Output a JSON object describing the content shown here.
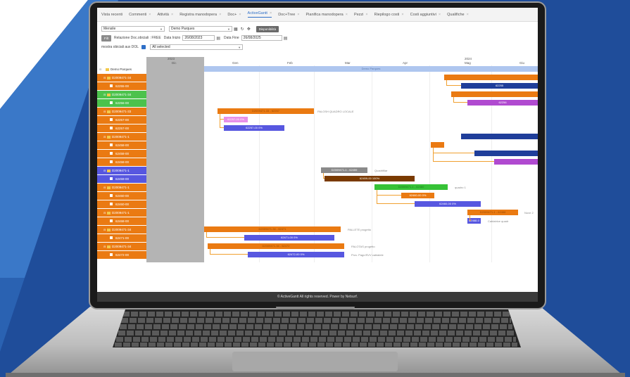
{
  "tabs": [
    {
      "label": "Vista recenti",
      "closable": false,
      "active": false
    },
    {
      "label": "Commenti",
      "closable": true,
      "active": false
    },
    {
      "label": "Attività",
      "closable": true,
      "active": false
    },
    {
      "label": "Registra manodopera",
      "closable": true,
      "active": false
    },
    {
      "label": "Doc+",
      "closable": true,
      "active": false
    },
    {
      "label": "ActiveGantt",
      "closable": true,
      "active": true
    },
    {
      "label": "Doc+Tree",
      "closable": true,
      "active": false
    },
    {
      "label": "Pianifica manodopera",
      "closable": true,
      "active": false
    },
    {
      "label": "Pezzi",
      "closable": true,
      "active": false
    },
    {
      "label": "Riepilogo costi",
      "closable": true,
      "active": false
    },
    {
      "label": "Costi aggiuntivi",
      "closable": true,
      "active": false
    },
    {
      "label": "Qualifiche",
      "closable": true,
      "active": false
    }
  ],
  "toolbar": {
    "mode_select": "Mensile",
    "project_select": "Demo Parques",
    "status_button": "Disponibilità",
    "filter_button": "Filt",
    "relazione_label": "Relazione Doc.obiciali : FREE",
    "data_inizio_label": "Data Inizio",
    "data_inizio_value": "26/08/2023",
    "data_fine_label": "Data Fine",
    "data_fine_value": "26/08/2025",
    "mostra_label": "mostra obiciali aux DOL",
    "all_selected": "All selected"
  },
  "timeline": {
    "years": [
      "2023",
      "2024"
    ],
    "months": [
      "Dic",
      "Gen",
      "Feb",
      "Mar",
      "Apr",
      "Mag",
      "Giu"
    ]
  },
  "rows": [
    {
      "label": "Demo Parques",
      "kind": "root",
      "color": "#ffffff"
    },
    {
      "label": "D2009471-34",
      "kind": "parent",
      "color": "#ea7a12"
    },
    {
      "label": "62255-00",
      "kind": "child",
      "color": "#ea7a12"
    },
    {
      "label": "D2009471-34",
      "kind": "parent",
      "color": "#4cc24c"
    },
    {
      "label": "62256-00",
      "kind": "child",
      "color": "#4cc24c"
    },
    {
      "label": "D2009471-33",
      "kind": "parent",
      "color": "#ea7a12"
    },
    {
      "label": "62257-00",
      "kind": "child",
      "color": "#ea7a12"
    },
    {
      "label": "62257-00",
      "kind": "child",
      "color": "#ea7a12"
    },
    {
      "label": "D2009471-1",
      "kind": "parent",
      "color": "#ea7a12"
    },
    {
      "label": "62458-00",
      "kind": "child",
      "color": "#ea7a12"
    },
    {
      "label": "62458-00",
      "kind": "child",
      "color": "#ea7a12"
    },
    {
      "label": "62458-00",
      "kind": "child",
      "color": "#ea7a12"
    },
    {
      "label": "D2009471-1",
      "kind": "parent",
      "color": "#5757e0"
    },
    {
      "label": "62459-00",
      "kind": "child",
      "color": "#5757e0"
    },
    {
      "label": "D2009471-1",
      "kind": "parent",
      "color": "#ea7a12"
    },
    {
      "label": "62460-00",
      "kind": "child",
      "color": "#ea7a12"
    },
    {
      "label": "62460-00",
      "kind": "child",
      "color": "#ea7a12"
    },
    {
      "label": "D2009471-1",
      "kind": "parent",
      "color": "#ea7a12"
    },
    {
      "label": "62468-00",
      "kind": "child",
      "color": "#ea7a12"
    },
    {
      "label": "D2009471-34",
      "kind": "parent",
      "color": "#ea7a12"
    },
    {
      "label": "62471-00",
      "kind": "child",
      "color": "#ea7a12"
    },
    {
      "label": "D2009471-34",
      "kind": "parent",
      "color": "#ea7a12"
    },
    {
      "label": "62472-00",
      "kind": "child",
      "color": "#ea7a12"
    }
  ],
  "bars": [
    {
      "row": 0,
      "start": 0.0,
      "end": 1.0,
      "color": "#aec6ef",
      "text": "Demo Parques",
      "textColor": "#5a7ab0"
    },
    {
      "row": 1,
      "start": 0.72,
      "end": 1.0,
      "color": "#ea7a12",
      "text": ""
    },
    {
      "row": 2,
      "start": 0.77,
      "end": 1.0,
      "color": "#1f3e9a",
      "text": "62255"
    },
    {
      "row": 3,
      "start": 0.74,
      "end": 1.0,
      "color": "#ea7a12",
      "text": ""
    },
    {
      "row": 4,
      "start": 0.79,
      "end": 1.0,
      "color": "#b04ad0",
      "text": "62256"
    },
    {
      "row": 5,
      "start": 0.04,
      "end": 0.33,
      "color": "#ea7a12",
      "text": "D2009471-33 - 62257",
      "textColor": "#9a4a00"
    },
    {
      "row": 6,
      "start": 0.06,
      "end": 0.13,
      "color": "#e890e8",
      "text": "62257-00 0%"
    },
    {
      "row": 7,
      "start": 0.06,
      "end": 0.24,
      "color": "#5757e0",
      "text": "62257-00 0%"
    },
    {
      "row": 8,
      "start": 0.77,
      "end": 1.0,
      "color": "#1f3e9a",
      "text": ""
    },
    {
      "row": 9,
      "start": 0.68,
      "end": 0.72,
      "color": "#ea7a12",
      "text": ""
    },
    {
      "row": 10,
      "start": 0.81,
      "end": 1.0,
      "color": "#1f3e9a",
      "text": ""
    },
    {
      "row": 11,
      "start": 0.87,
      "end": 1.0,
      "color": "#b04ad0",
      "text": ""
    },
    {
      "row": 12,
      "start": 0.35,
      "end": 0.49,
      "color": "#8a8a8a",
      "text": "D2009471-1 - 62459"
    },
    {
      "row": 13,
      "start": 0.36,
      "end": 0.63,
      "color": "#7a3a00",
      "text": "62459-00 100%"
    },
    {
      "row": 14,
      "start": 0.51,
      "end": 0.73,
      "color": "#36c236",
      "text": "D2009471-1 - 62460",
      "textColor": "#1a7a1a"
    },
    {
      "row": 15,
      "start": 0.59,
      "end": 0.69,
      "color": "#ea7a12",
      "text": "62460-00 0%"
    },
    {
      "row": 16,
      "start": 0.63,
      "end": 0.83,
      "color": "#5757e0",
      "text": "62460-00 0%"
    },
    {
      "row": 17,
      "start": 0.79,
      "end": 0.94,
      "color": "#ea7a12",
      "text": "D2009471-1 - 62468",
      "textColor": "#9a4a00"
    },
    {
      "row": 18,
      "start": 0.79,
      "end": 0.83,
      "color": "#5757e0",
      "text": "62468-0"
    },
    {
      "row": 19,
      "start": 0.0,
      "end": 0.41,
      "color": "#ea7a12",
      "text": "D2009471-34 - 62471",
      "textColor": "#9a4a00"
    },
    {
      "row": 20,
      "start": 0.12,
      "end": 0.39,
      "color": "#5757e0",
      "text": "62471-00 0%"
    },
    {
      "row": 21,
      "start": 0.01,
      "end": 0.42,
      "color": "#ea7a12",
      "text": "D2009471-34 - 62472",
      "textColor": "#9a4a00"
    },
    {
      "row": 22,
      "start": 0.13,
      "end": 0.42,
      "color": "#5757e0",
      "text": "62472-00 0%"
    }
  ],
  "side_labels": [
    {
      "row": 5,
      "after": 0.34,
      "text": "PALOSH QUADRO LOCALE"
    },
    {
      "row": 12,
      "after": 0.51,
      "text": "Quadrifilar"
    },
    {
      "row": 14,
      "after": 0.75,
      "text": "quadro 1"
    },
    {
      "row": 17,
      "after": 0.96,
      "text": "Nove 2"
    },
    {
      "row": 18,
      "after": 0.85,
      "text": "Cablatrice quadr"
    },
    {
      "row": 19,
      "after": 0.43,
      "text": "PALLETE progetto"
    },
    {
      "row": 21,
      "after": 0.44,
      "text": "PALOTAS progetto"
    },
    {
      "row": 22,
      "after": 0.44,
      "text": "Prov. Pagn/SVV cablatele"
    }
  ],
  "footer": "© ActiveGantt All rights reserved. Power by Netsurf."
}
